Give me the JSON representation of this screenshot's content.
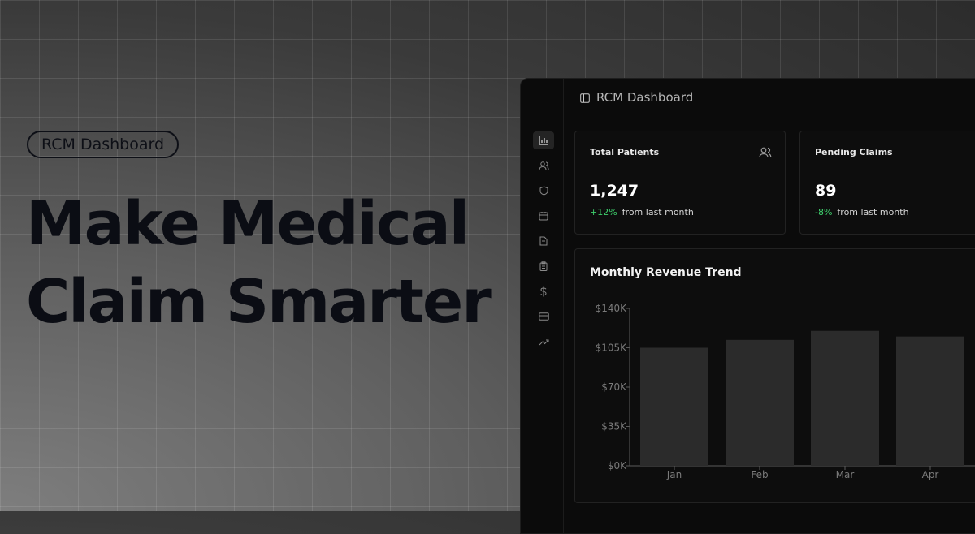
{
  "hero": {
    "badge": "RCM Dashboard",
    "headline_line1": "Make Medical",
    "headline_line2": "Claim Smarter"
  },
  "app": {
    "title": "RCM Dashboard",
    "sidebar_icons": [
      "bar-chart-icon",
      "users-icon",
      "shield-icon",
      "calendar-icon",
      "file-text-icon",
      "clipboard-icon",
      "dollar-icon",
      "credit-card-icon",
      "trending-up-icon"
    ],
    "active_sidebar": "bar-chart-icon"
  },
  "stats": [
    {
      "label": "Total Patients",
      "value": "1,247",
      "delta": "+12%",
      "delta_text": "from last month",
      "icon": "users-icon"
    },
    {
      "label": "Pending Claims",
      "value": "89",
      "delta": "-8%",
      "delta_text": "from last month"
    }
  ],
  "chart_data": {
    "type": "bar",
    "title": "Monthly Revenue Trend",
    "categories": [
      "Jan",
      "Feb",
      "Mar",
      "Apr"
    ],
    "values": [
      105000,
      112000,
      120000,
      115000
    ],
    "ylim": [
      0,
      140000
    ],
    "yticks": [
      0,
      35000,
      70000,
      105000,
      140000
    ],
    "ytick_labels": [
      "$0K",
      "$35K",
      "$70K",
      "$105K",
      "$140K"
    ],
    "bar_color": "#2b2b2b",
    "grid": false
  },
  "colors": {
    "positive": "#3ecf6c",
    "window_bg": "#0b0b0b",
    "headline": "#0b0d14"
  }
}
